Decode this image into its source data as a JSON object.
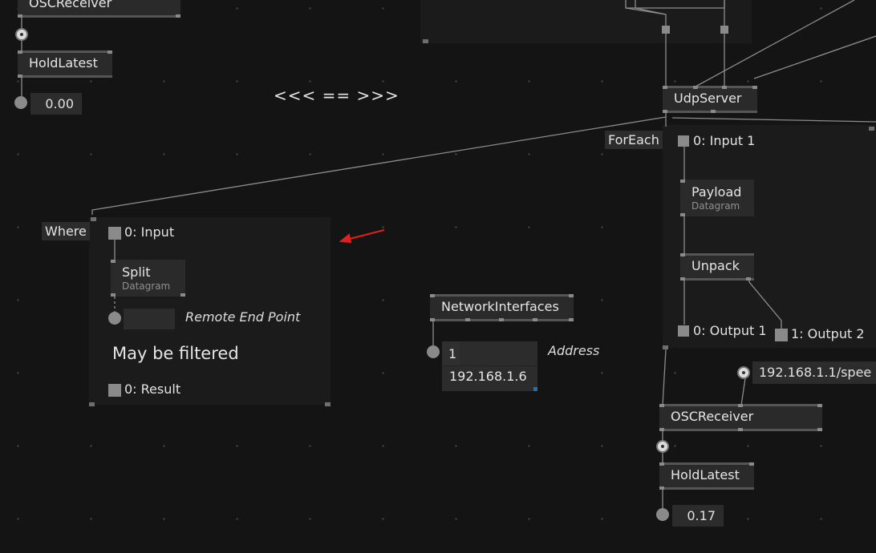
{
  "top_left": {
    "osc_receiver": "OSCReceiver",
    "hold_latest": "HoldLatest",
    "value": "0.00"
  },
  "comment": "<<< == >>>",
  "udp_server": "UdpServer",
  "foreach": {
    "tag": "ForEach",
    "input": "0: Input 1",
    "payload": "Payload",
    "payload_sub": "Datagram",
    "unpack": "Unpack",
    "output1": "0: Output 1",
    "output2": "1: Output 2"
  },
  "where": {
    "tag": "Where",
    "input": "0: Input",
    "split": "Split",
    "split_sub": "Datagram",
    "remote_end_point": "Remote End Point",
    "note": "May be filtered",
    "result": "0: Result"
  },
  "network": {
    "node": "NetworkInterfaces",
    "index": "1",
    "address_value": "192.168.1.6",
    "address_label": "Address"
  },
  "bottom_right": {
    "address_path": "192.168.1.1/spee",
    "osc_receiver": "OSCReceiver",
    "hold_latest": "HoldLatest",
    "value": "0.17"
  },
  "colors": {
    "background": "#141414",
    "region": "#1b1b1b",
    "node": "#2a2a2a",
    "wire": "#8c8c8c",
    "arrow": "#e0201c"
  }
}
